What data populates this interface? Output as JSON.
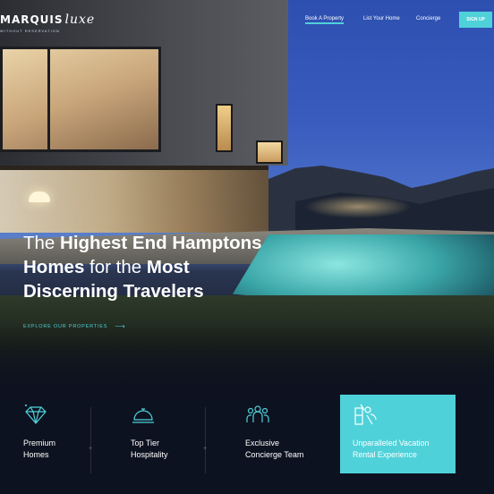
{
  "nav": {
    "logo_text": "MARQUIS",
    "logo_script": "luxe",
    "logo_tagline": "WITHOUT RESERVATION",
    "links": [
      "Book A Property",
      "List Your Home",
      "Concierge"
    ],
    "signup_label": "SIGN UP"
  },
  "hero": {
    "headline": {
      "l1_a": "The ",
      "l1_b": "Highest End Hamptons",
      "l2_a": "Homes",
      "l2_b": " for the ",
      "l2_c": "Most",
      "l3": "Discerning Travelers"
    },
    "explore_label": "EXPLORE OUR PROPERTIES",
    "explore_arrow": "⟶"
  },
  "features": [
    {
      "icon": "diamond-icon",
      "label": "Premium\nHomes"
    },
    {
      "icon": "service-bell-icon",
      "label": "Top Tier\nHospitality"
    },
    {
      "icon": "team-icon",
      "label": "Exclusive\nConcierge Team"
    },
    {
      "icon": "beach-drink-icon",
      "label": "Unparalleled Vacation\nRental Experience"
    }
  ],
  "colors": {
    "accent": "#4fd1d9",
    "background": "#0d1220"
  }
}
